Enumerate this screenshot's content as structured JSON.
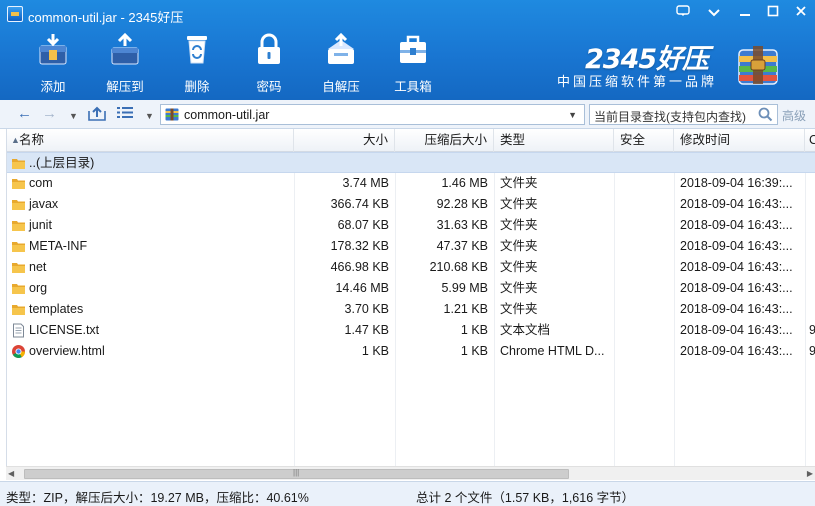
{
  "window": {
    "title": "common-util.jar - 2345好压"
  },
  "toolbar": {
    "items": [
      {
        "label": "添加",
        "icon": "add-archive-icon"
      },
      {
        "label": "解压到",
        "icon": "extract-icon"
      },
      {
        "label": "删除",
        "icon": "recycle-bin-icon"
      },
      {
        "label": "密码",
        "icon": "lock-icon"
      },
      {
        "label": "自解压",
        "icon": "self-extract-icon"
      },
      {
        "label": "工具箱",
        "icon": "toolbox-icon"
      }
    ],
    "brand": "2345好压",
    "slogan": "中国压缩软件第一品牌"
  },
  "address": {
    "path": "common-util.jar",
    "search_placeholder": "当前目录查找(支持包内查找)",
    "advanced_label": "高级"
  },
  "columns": {
    "name": "名称",
    "size": "大小",
    "compressed": "压缩后大小",
    "type": "类型",
    "security": "安全",
    "modified": "修改时间",
    "crc": "C"
  },
  "parent_row": "..(上层目录)",
  "rows": [
    {
      "name": "com",
      "size": "3.74 MB",
      "compressed": "1.46 MB",
      "type": "文件夹",
      "modified": "2018-09-04 16:39:...",
      "crc": "",
      "icon": "folder-icon"
    },
    {
      "name": "javax",
      "size": "366.74 KB",
      "compressed": "92.28 KB",
      "type": "文件夹",
      "modified": "2018-09-04 16:43:...",
      "crc": "",
      "icon": "folder-icon"
    },
    {
      "name": "junit",
      "size": "68.07 KB",
      "compressed": "31.63 KB",
      "type": "文件夹",
      "modified": "2018-09-04 16:43:...",
      "crc": "",
      "icon": "folder-icon"
    },
    {
      "name": "META-INF",
      "size": "178.32 KB",
      "compressed": "47.37 KB",
      "type": "文件夹",
      "modified": "2018-09-04 16:43:...",
      "crc": "",
      "icon": "folder-icon"
    },
    {
      "name": "net",
      "size": "466.98 KB",
      "compressed": "210.68 KB",
      "type": "文件夹",
      "modified": "2018-09-04 16:43:...",
      "crc": "",
      "icon": "folder-icon"
    },
    {
      "name": "org",
      "size": "14.46 MB",
      "compressed": "5.99 MB",
      "type": "文件夹",
      "modified": "2018-09-04 16:43:...",
      "crc": "",
      "icon": "folder-icon"
    },
    {
      "name": "templates",
      "size": "3.70 KB",
      "compressed": "1.21 KB",
      "type": "文件夹",
      "modified": "2018-09-04 16:43:...",
      "crc": "",
      "icon": "folder-icon"
    },
    {
      "name": "LICENSE.txt",
      "size": "1.47 KB",
      "compressed": "1 KB",
      "type": "文本文档",
      "modified": "2018-09-04 16:43:...",
      "crc": "9",
      "icon": "text-file-icon"
    },
    {
      "name": "overview.html",
      "size": "1 KB",
      "compressed": "1 KB",
      "type": "Chrome HTML D...",
      "modified": "2018-09-04 16:43:...",
      "crc": "9",
      "icon": "chrome-icon"
    }
  ],
  "status": {
    "left": "类型：ZIP，解压后大小：19.27 MB，压缩比：40.61%",
    "right": "总计 2 个文件（1.57 KB，1,616 字节）"
  },
  "colors": {
    "toolbar_blue": "#1976d2",
    "selection_row": "#d9e6f6",
    "folder_yellow": "#f3c04a"
  }
}
